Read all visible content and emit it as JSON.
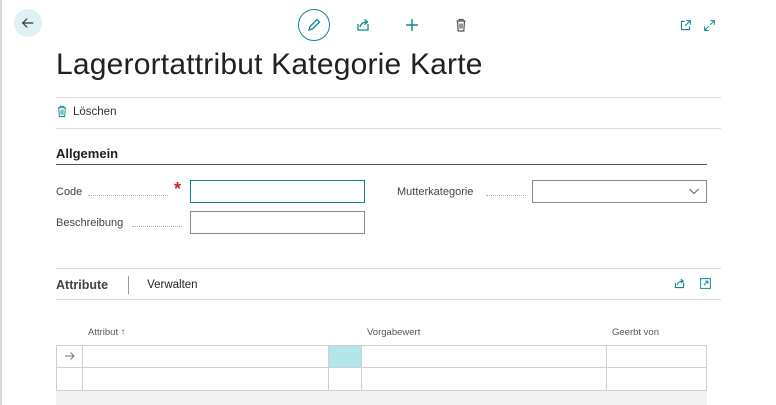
{
  "header": {
    "title": "Lagerortattribut Kategorie Karte",
    "icons": [
      "back-arrow-icon",
      "edit-pencil-icon",
      "share-icon",
      "add-icon",
      "delete-icon",
      "open-new-window-icon",
      "expand-icon"
    ]
  },
  "actions": {
    "delete_label": "Löschen"
  },
  "general": {
    "section_title": "Allgemein",
    "code_label": "Code",
    "code_value": "",
    "description_label": "Beschreibung",
    "description_value": "",
    "parent_category_label": "Mutterkategorie",
    "parent_category_value": ""
  },
  "attributes": {
    "title": "Attribute",
    "manage_label": "Verwalten",
    "columns": {
      "attribute": "Attribut ↑",
      "default_value": "Vorgabewert",
      "inherited_from": "Geerbt von"
    }
  },
  "colors": {
    "accent": "#0a8a8f",
    "active_cell": "#b2e6ea",
    "required": "#c62828"
  }
}
